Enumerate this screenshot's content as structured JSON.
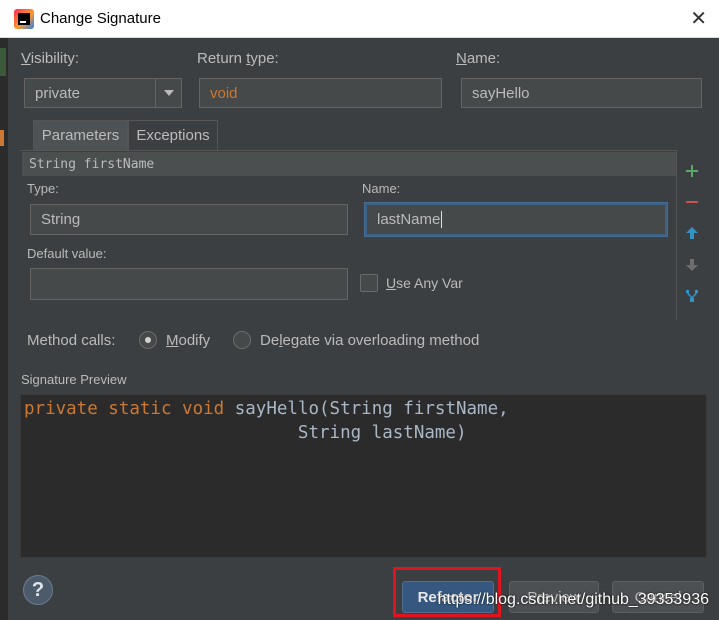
{
  "window": {
    "title": "Change Signature"
  },
  "visibility": {
    "label": "Visibility:",
    "mnemonic": "V",
    "rest": "isibility:",
    "value": "private"
  },
  "return_type": {
    "label_pre": "Return ",
    "mnemonic": "t",
    "label_post": "ype:",
    "value": "void"
  },
  "name": {
    "mnemonic": "N",
    "rest": "ame:",
    "value": "sayHello"
  },
  "tabs": [
    {
      "label": "Parameters",
      "active": true
    },
    {
      "label": "Exceptions",
      "active": false
    }
  ],
  "parameter": {
    "row_text": "String firstName",
    "type_label": "Type:",
    "type_value": "String",
    "name_label": "Name:",
    "name_value": "lastName",
    "default_label": "Default value:",
    "default_value": "",
    "use_any_var_mnemonic": "U",
    "use_any_var_rest": "se Any Var",
    "use_any_var_checked": false
  },
  "toolbar": {
    "icons": [
      "add-icon",
      "remove-icon",
      "move-up-icon",
      "move-down-icon",
      "propagate-icon"
    ]
  },
  "method_calls": {
    "label": "Method calls:",
    "modify_mnemonic": "M",
    "modify_rest": "odify",
    "delegate_pre": "De",
    "delegate_mnemonic": "l",
    "delegate_post": "egate via overloading method",
    "selected": "modify"
  },
  "preview": {
    "label": "Signature Preview",
    "line1_kw": "private static void",
    "line1_rest": " sayHello(String firstName,",
    "line2": "                          String lastName)"
  },
  "buttons": {
    "help": "?",
    "refactor": "Refactor",
    "preview": "Preview",
    "cancel": "Cancel"
  },
  "watermark": "https://blog.csdn.net/github_39353936",
  "colors": {
    "background": "#3c3f41",
    "keyword": "#cc7832",
    "accent_button": "#365880",
    "highlight_box": "#e0141e"
  }
}
